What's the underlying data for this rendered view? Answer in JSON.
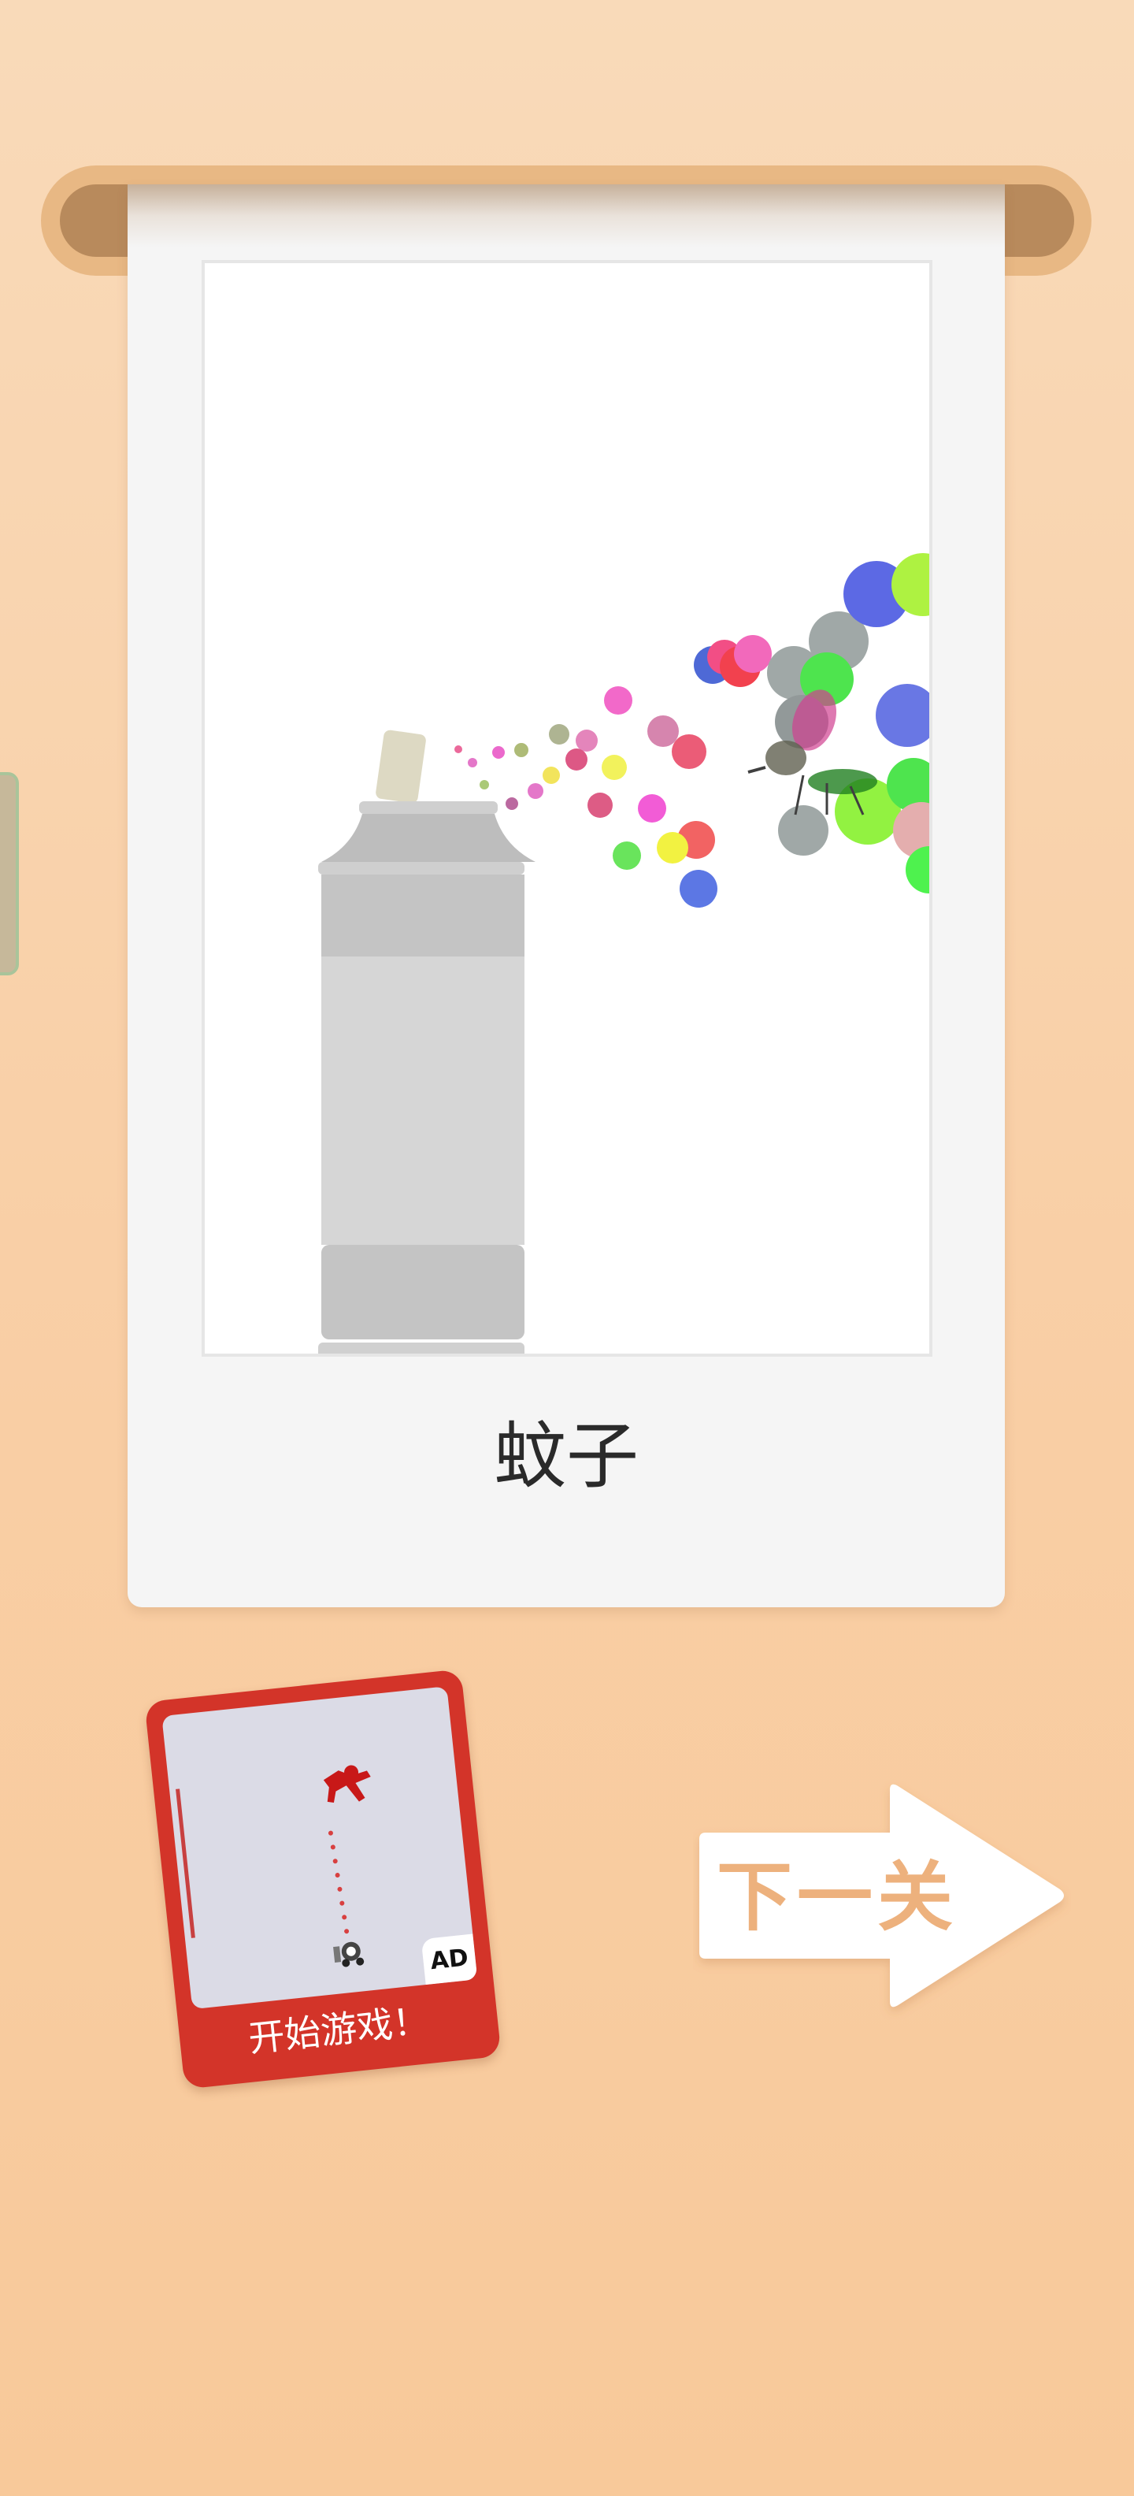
{
  "level": {
    "answer": "蚊子"
  },
  "ad": {
    "badge": "AD",
    "label": "开始游戏！"
  },
  "navigation": {
    "next_label": "下一关"
  },
  "colors": {
    "background": "#f9d3ad",
    "card": "#f5f5f5",
    "scroll": "#b88a5c",
    "ad_frame": "#d33429",
    "next_text": "#edb17d"
  }
}
